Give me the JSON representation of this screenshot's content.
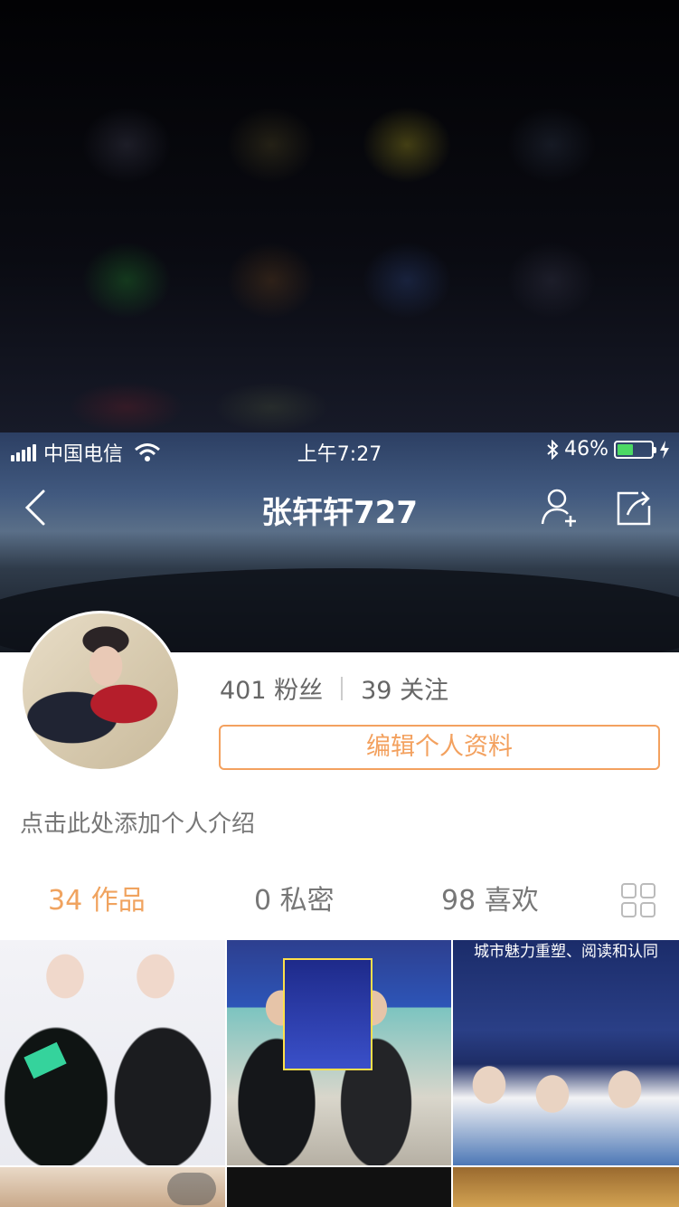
{
  "status_bar": {
    "carrier": "中国电信",
    "time": "上午7:27",
    "battery_percent": "46%",
    "battery_level": 0.46
  },
  "nav": {
    "title": "张轩轩727",
    "icons": [
      "back-chevron-icon",
      "add-friend-icon",
      "share-icon"
    ]
  },
  "profile": {
    "followers": "401 粉丝",
    "following": "39 关注",
    "edit_label": "编辑个人资料",
    "bio_placeholder": "点击此处添加个人介绍"
  },
  "tabs": [
    {
      "label": "34 作品",
      "active": true
    },
    {
      "label": "0 私密",
      "active": false
    },
    {
      "label": "98 喜欢",
      "active": false
    }
  ],
  "thumbnail_texts": {
    "third_banner": "城市魅力重塑、阅读和认同"
  },
  "colors": {
    "accent": "#f3a15f",
    "battery_fill": "#4cd964"
  }
}
